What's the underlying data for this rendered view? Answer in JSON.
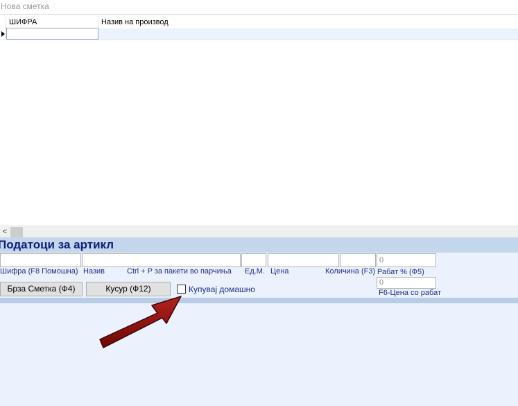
{
  "window": {
    "title": "Нова сметка"
  },
  "grid": {
    "columns": [
      {
        "label": "ШИФРА"
      },
      {
        "label": "Назив на производ"
      }
    ]
  },
  "scrollbar": {
    "left_arrow": "<"
  },
  "panel": {
    "title": "Податоци за артикл",
    "labels": {
      "sifra": "Шифра (F8 Помошна)",
      "naziv": "Назив",
      "ctrl_p": "Ctrl + P за  пакети во парчиња",
      "edm": "Ед.М.",
      "cena": "Цена",
      "kolicina": "Количина (F3)",
      "rabat": "Рабат % (Ф5)",
      "cena_rabat": "F6-Цена со рабат"
    },
    "fields": {
      "rabat_value": "0",
      "cena_rabat_value": "0"
    },
    "buttons": {
      "brza_smetka": "Брза Сметка (Ф4)",
      "kusur": "Кусур (Ф12)"
    },
    "checkbox": {
      "label": "Купувај домашно",
      "checked": false
    }
  },
  "colors": {
    "panel_header_bg": "#c3d6ec",
    "panel_bg": "#ecf2fd",
    "label_text": "#1f2d8c",
    "arrow": "#8b1010"
  }
}
